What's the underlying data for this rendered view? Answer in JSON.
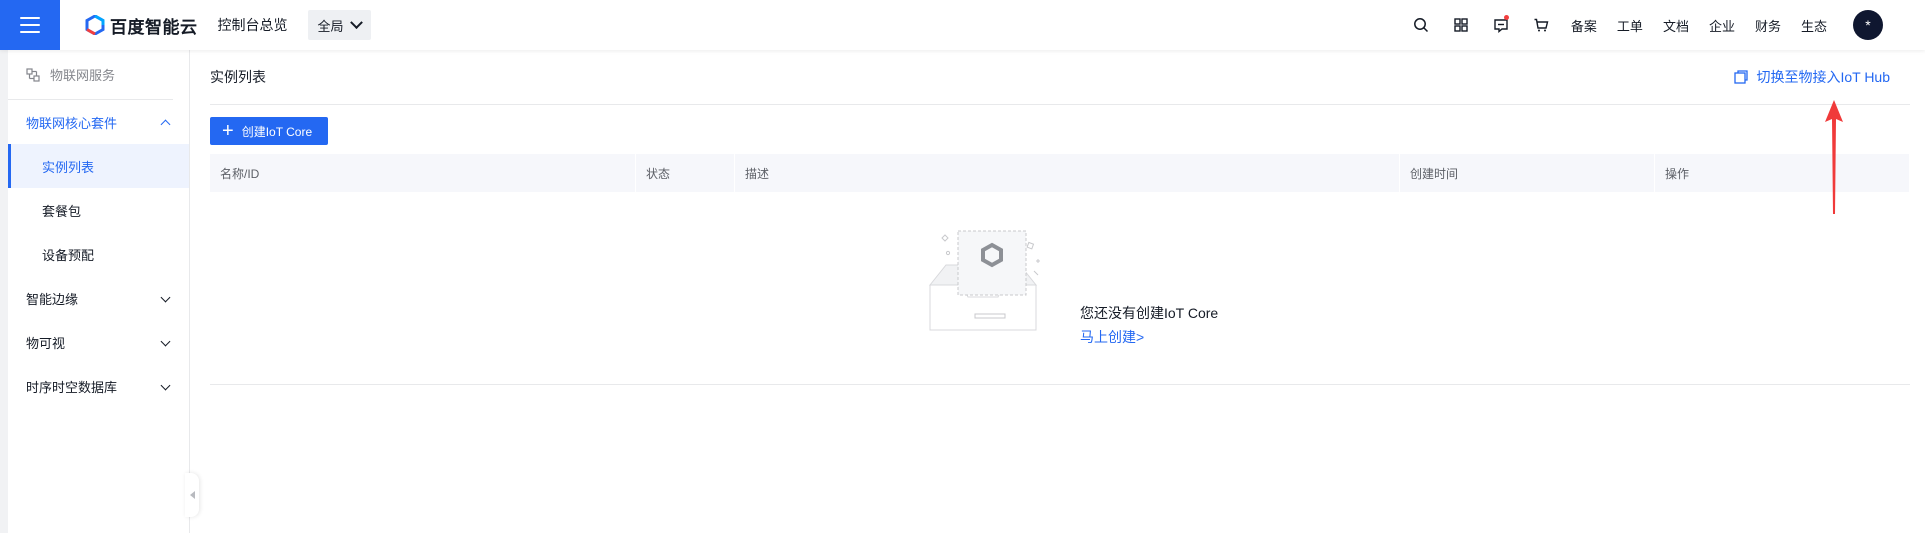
{
  "topbar": {
    "brand": "百度智能云",
    "console_overview": "控制台总览",
    "region": "全局",
    "nav": [
      "备案",
      "工单",
      "文档",
      "企业",
      "财务",
      "生态"
    ],
    "avatar_text": "*",
    "icons": [
      "search-icon",
      "apps-icon",
      "message-icon",
      "cart-icon"
    ]
  },
  "sidebar": {
    "header": "物联网服务",
    "groups": [
      {
        "label": "物联网核心套件",
        "expanded": true,
        "items": [
          "实例列表",
          "套餐包",
          "设备预配"
        ]
      },
      {
        "label": "智能边缘",
        "expanded": false
      },
      {
        "label": "物可视",
        "expanded": false
      },
      {
        "label": "时序时空数据库",
        "expanded": false
      }
    ],
    "selected_item": "实例列表"
  },
  "main": {
    "title": "实例列表",
    "switch_link": "切换至物接入IoT Hub",
    "create_button": "创建IoT Core",
    "columns": [
      "名称/ID",
      "状态",
      "描述",
      "创建时间",
      "操作"
    ],
    "empty_message": "您还没有创建IoT Core",
    "empty_link": "马上创建>"
  },
  "colors": {
    "primary": "#2468f2",
    "annotation": "#f03a3a"
  }
}
